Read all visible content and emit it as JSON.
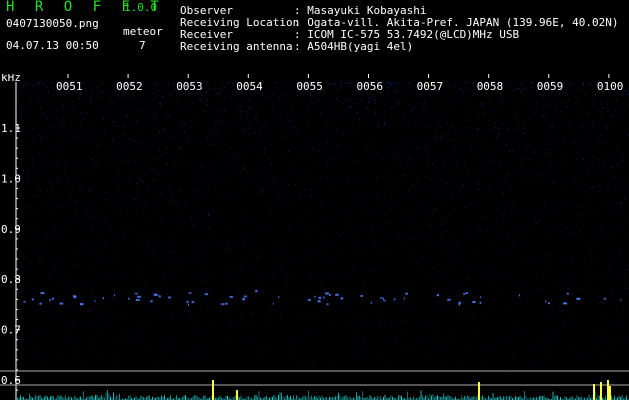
{
  "app": {
    "name": "H R O F F T",
    "version": "1.0.0"
  },
  "file": {
    "name": "0407130050.png",
    "datetime": "04.07.13 00:50"
  },
  "meteor": {
    "label": "meteor",
    "count": "7"
  },
  "info": [
    {
      "label": "Observer",
      "value": ": Masayuki Kobayashi"
    },
    {
      "label": "Receiving Location",
      "value": ": Ogata-vill. Akita-Pref. JAPAN (139.96E, 40.02N)"
    },
    {
      "label": "Receiver",
      "value": ": ICOM IC-575 53.7492(@LCD)MHz USB"
    },
    {
      "label": "Receiving antenna",
      "value": ": A504HB(yagi 4el)"
    }
  ],
  "axis": {
    "unit": "kHz",
    "y_ticks": [
      "1.1",
      "1.0",
      "0.9",
      "0.8",
      "0.7",
      "0.6"
    ],
    "x_ticks": [
      "0051",
      "0052",
      "0053",
      "0054",
      "0055",
      "0056",
      "0057",
      "0058",
      "0059",
      "0100"
    ]
  },
  "colors": {
    "background": "#000000",
    "text": "#ffffff",
    "accent_green": "#22e022",
    "noise_blue": "#2828a0",
    "echo_blue": "#4a7cff",
    "spike_yellow": "#ffff40",
    "baseline_cyan": "#20c8c8"
  }
}
